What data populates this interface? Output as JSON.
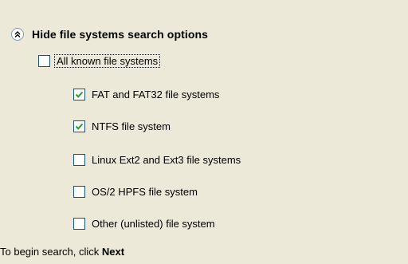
{
  "section": {
    "toggle_label": "Hide file systems search options"
  },
  "options": {
    "all": {
      "label": "All known file systems",
      "checked": false
    },
    "items": [
      {
        "label": "FAT and FAT32 file systems",
        "checked": true
      },
      {
        "label": "NTFS file system",
        "checked": true
      },
      {
        "label": "Linux Ext2 and Ext3 file systems",
        "checked": false
      },
      {
        "label": "OS/2 HPFS file system",
        "checked": false
      },
      {
        "label": "Other (unlisted) file system",
        "checked": false
      }
    ]
  },
  "footer": {
    "prefix": "To begin search, click ",
    "action": "Next"
  },
  "icons": {
    "collapse": "double-chevron-up-icon",
    "check": "checkmark-icon"
  },
  "colors": {
    "background": "#ECE9D8",
    "checkbox_border": "#1C5180",
    "checkmark": "#21A121"
  }
}
